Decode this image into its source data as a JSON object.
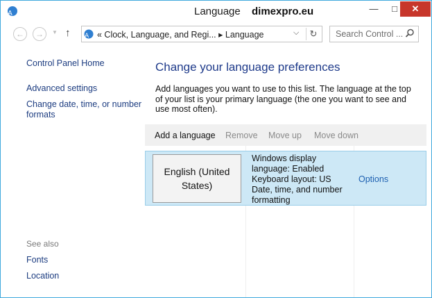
{
  "window": {
    "title": "Language",
    "watermark": "dimexpro.eu",
    "min_icon": "minimize-icon",
    "max_icon": "maximize-icon",
    "close_icon": "close-icon"
  },
  "nav": {
    "back_glyph": "←",
    "forward_glyph": "→",
    "recent_glyph": "▼",
    "up_glyph": "↑",
    "breadcrumb": "«  Clock, Language, and Regi...  ▸  Language",
    "address_drop_glyph": "⌵",
    "refresh_glyph": "↻",
    "search_placeholder": "Search Control ..."
  },
  "sidebar": {
    "home": "Control Panel Home",
    "advanced": "Advanced settings",
    "date_time": "Change date, time, or number formats",
    "see_also": "See also",
    "fonts": "Fonts",
    "location": "Location"
  },
  "main": {
    "heading": "Change your language preferences",
    "description": "Add languages you want to use to this list. The language at the top of your list is your primary language (the one you want to see and use most often).",
    "toolbar": {
      "add": "Add a language",
      "remove": "Remove",
      "move_up": "Move up",
      "move_down": "Move down"
    },
    "languages": [
      {
        "name": "English (United States)",
        "details": [
          "Windows display language: Enabled",
          "Keyboard layout: US",
          "Date, time, and number formatting"
        ],
        "options": "Options"
      }
    ]
  },
  "colors": {
    "accent": "#3fa9dd",
    "link": "#1c3c80",
    "selected_row": "#cde8f6",
    "close_button": "#c7362b"
  }
}
